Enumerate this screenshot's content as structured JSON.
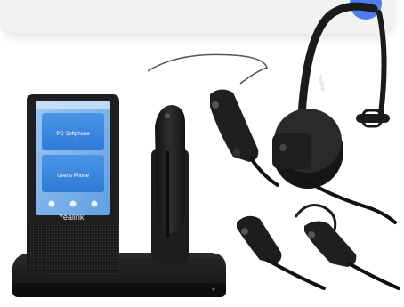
{
  "product": {
    "base_brand": "Yealink",
    "headband_brand": "Yealink",
    "screen": {
      "tile_1_label": "PC Softphone",
      "tile_2_label": "User's Phone"
    }
  },
  "colors": {
    "background": "#ffffff",
    "card": "#f1f2f4",
    "accent_dot": "#4f7df0",
    "device_black": "#1c1c1e",
    "screen_blue": "#3f86dc"
  }
}
